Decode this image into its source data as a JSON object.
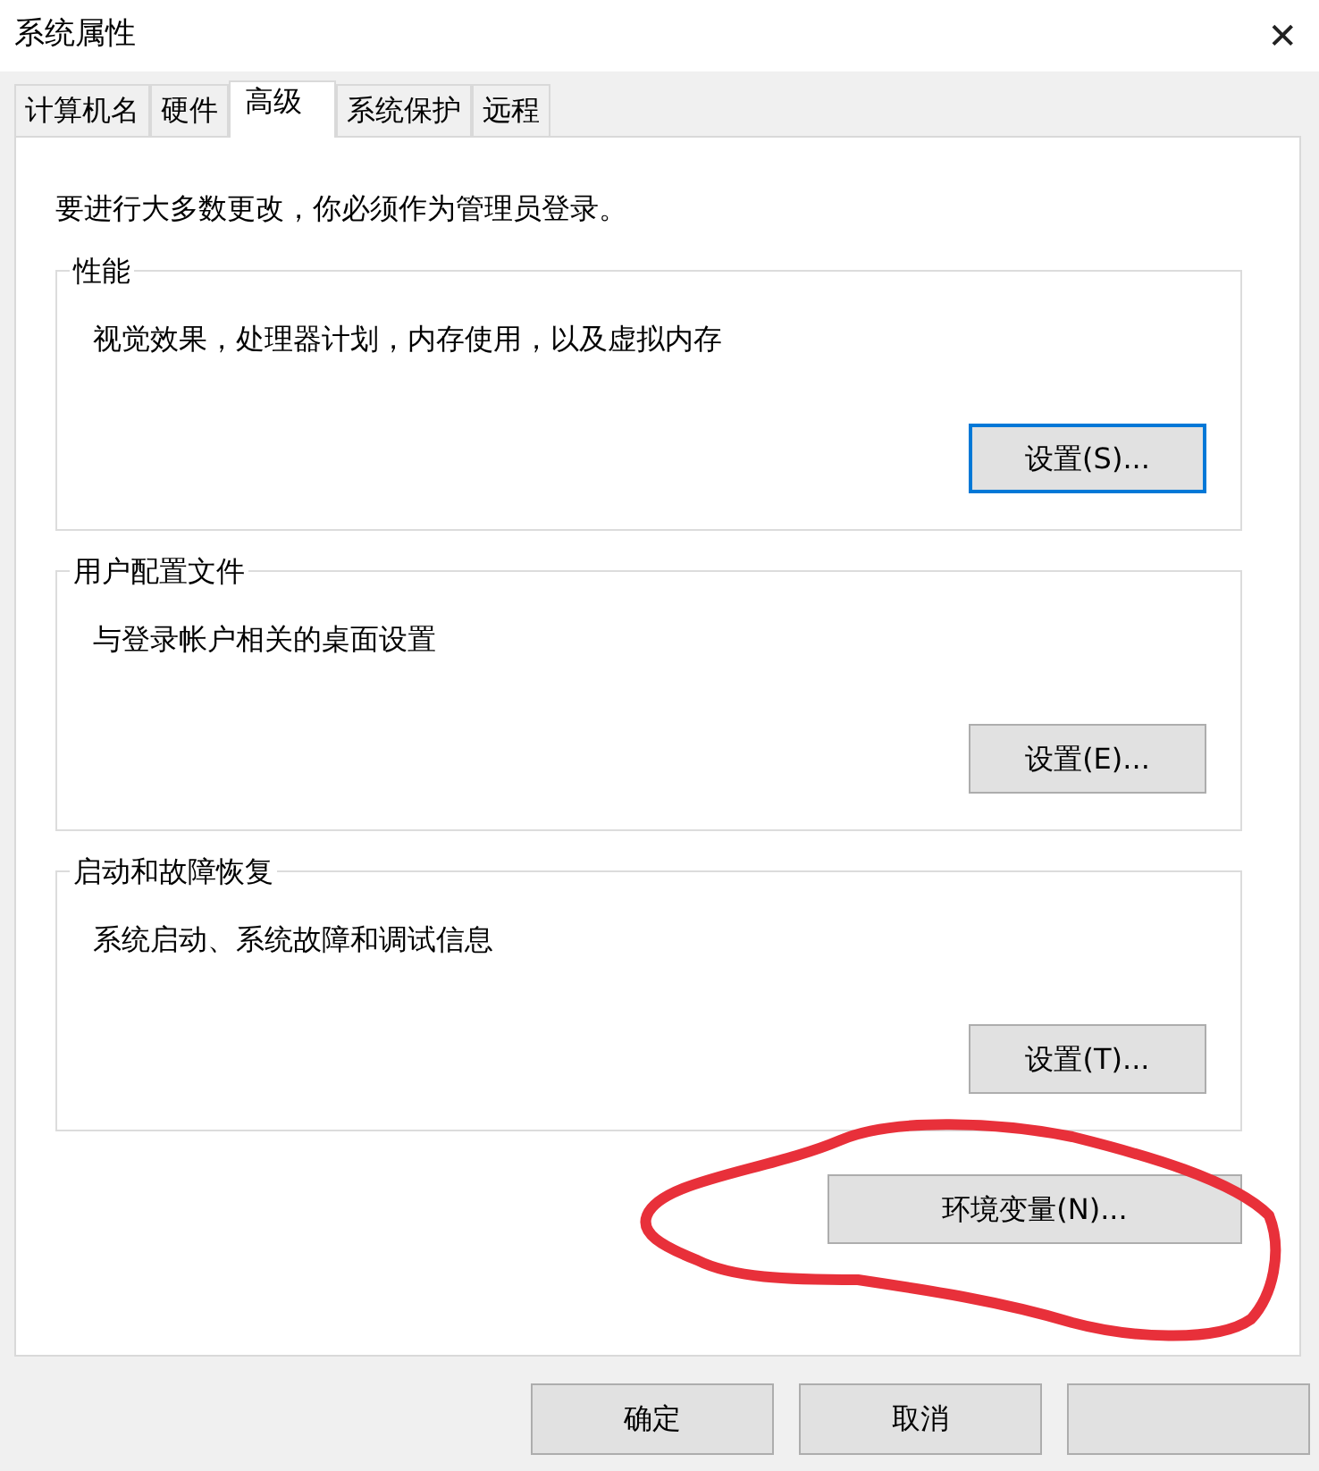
{
  "window": {
    "title": "系统属性",
    "close": "✕"
  },
  "tabs": [
    {
      "label": "计算机名",
      "selected": false
    },
    {
      "label": "硬件",
      "selected": false
    },
    {
      "label": "高级",
      "selected": true
    },
    {
      "label": "系统保护",
      "selected": false
    },
    {
      "label": "远程",
      "selected": false
    }
  ],
  "notice": "要进行大多数更改，你必须作为管理员登录。",
  "groups": [
    {
      "title": "性能",
      "description": "视觉效果，处理器计划，内存使用，以及虚拟内存",
      "button": {
        "label": "设置(S)...",
        "focused": true
      }
    },
    {
      "title": "用户配置文件",
      "description": "与登录帐户相关的桌面设置",
      "button": {
        "label": "设置(E)...",
        "focused": false
      }
    },
    {
      "title": "启动和故障恢复",
      "description": "系统启动、系统故障和调试信息",
      "button": {
        "label": "设置(T)...",
        "focused": false
      }
    }
  ],
  "env_button": "环境变量(N)...",
  "footer_buttons": [
    {
      "kind": "text",
      "label": "确定"
    },
    {
      "kind": "text",
      "label": "取消"
    },
    {
      "kind": "hidden"
    }
  ]
}
